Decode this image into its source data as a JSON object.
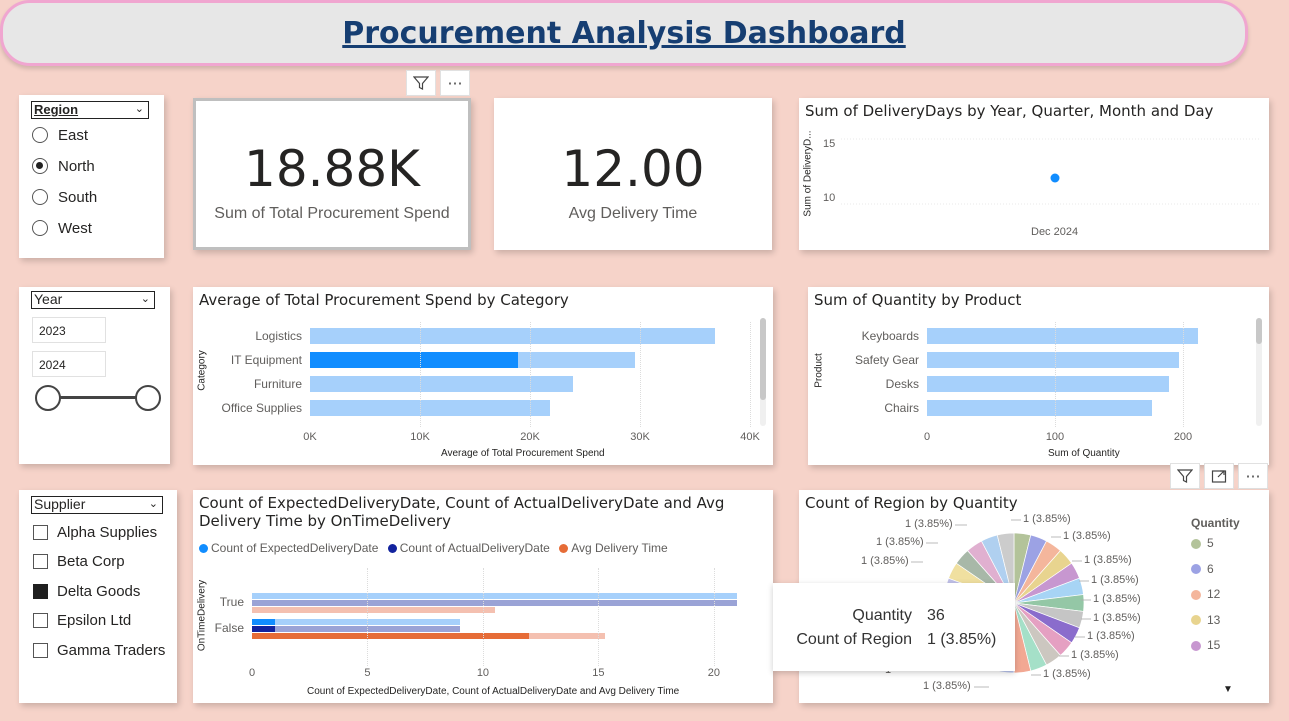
{
  "title": "Procurement Analysis Dashboard",
  "region_slicer": {
    "header": "Region",
    "items": [
      {
        "label": "East",
        "selected": false
      },
      {
        "label": "North",
        "selected": true
      },
      {
        "label": "South",
        "selected": false
      },
      {
        "label": "West",
        "selected": false
      }
    ]
  },
  "year_slicer": {
    "header": "Year",
    "from": "2023",
    "to": "2024"
  },
  "supplier_slicer": {
    "header": "Supplier",
    "items": [
      {
        "label": "Alpha Supplies",
        "checked": false
      },
      {
        "label": "Beta Corp",
        "checked": false
      },
      {
        "label": "Delta Goods",
        "checked": true
      },
      {
        "label": "Epsilon Ltd",
        "checked": false
      },
      {
        "label": "Gamma Traders",
        "checked": false
      }
    ]
  },
  "kpi_spend": {
    "value": "18.88K",
    "label": "Sum of Total Procurement Spend"
  },
  "kpi_delivery": {
    "value": "12.00",
    "label": "Avg Delivery Time"
  },
  "delivery_days_chart": {
    "title": "Sum of DeliveryDays by Year, Quarter, Month and Day",
    "ylabel": "Sum of DeliveryD...",
    "y_ticks": [
      "15",
      "10"
    ],
    "x_tick": "Dec 2024"
  },
  "category_chart": {
    "title": "Average of Total Procurement Spend by Category",
    "ylabel": "Category",
    "xlabel": "Average of Total Procurement Spend",
    "x_ticks": [
      "0K",
      "10K",
      "20K",
      "30K",
      "40K"
    ]
  },
  "product_chart": {
    "title": "Sum of Quantity by Product",
    "ylabel": "Product",
    "xlabel": "Sum of Quantity",
    "x_ticks": [
      "0",
      "100",
      "200"
    ]
  },
  "ontime_chart": {
    "title_line1": "Count of ExpectedDeliveryDate, Count of ActualDeliveryDate and Avg",
    "title_line2": "Delivery Time by OnTimeDelivery",
    "legend": [
      "Count of ExpectedDeliveryDate",
      "Count of ActualDeliveryDate",
      "Avg Delivery Time"
    ],
    "ylabel": "OnTimeDelivery",
    "xlabel": "Count of ExpectedDeliveryDate, Count of ActualDeliveryDate and Avg Delivery Time",
    "x_ticks": [
      "0",
      "5",
      "10",
      "15",
      "20"
    ]
  },
  "region_pie": {
    "title": "Count of Region by Quantity",
    "legend_title": "Quantity",
    "slice_label": "1 (3.85%)",
    "slice_label_stub": "1",
    "tooltip": {
      "k1": "Quantity",
      "v1": "36",
      "k2": "Count of Region",
      "v2": "1 (3.85%)"
    }
  },
  "chart_data": [
    {
      "type": "scatter",
      "title": "Sum of DeliveryDays by Year, Quarter, Month and Day",
      "x": [
        "Dec 2024"
      ],
      "y": [
        12
      ],
      "ylabel": "Sum of DeliveryD...",
      "ylim": [
        8,
        16
      ]
    },
    {
      "type": "bar",
      "orientation": "horizontal",
      "title": "Average of Total Procurement Spend by Category",
      "categories": [
        "Logistics",
        "IT Equipment",
        "Furniture",
        "Office Supplies"
      ],
      "values": [
        36800,
        29500,
        23900,
        21800
      ],
      "highlight_values": [
        null,
        18900,
        null,
        null
      ],
      "xlabel": "Average of Total Procurement Spend",
      "ylabel": "Category",
      "xlim": [
        0,
        40000
      ],
      "colors": {
        "base": "#a6d0fb",
        "highlight": "#118dff"
      }
    },
    {
      "type": "bar",
      "orientation": "horizontal",
      "title": "Sum of Quantity by Product",
      "categories": [
        "Keyboards",
        "Safety Gear",
        "Desks",
        "Chairs"
      ],
      "values": [
        212,
        197,
        189,
        176
      ],
      "xlabel": "Sum of Quantity",
      "ylabel": "Product",
      "xlim": [
        0,
        250
      ],
      "colors": {
        "base": "#a6d0fb"
      }
    },
    {
      "type": "bar",
      "orientation": "horizontal",
      "title": "Count of ExpectedDeliveryDate, Count of ActualDeliveryDate and Avg Delivery Time by OnTimeDelivery",
      "categories": [
        "True",
        "False"
      ],
      "series": [
        {
          "name": "Count of ExpectedDeliveryDate",
          "values": [
            21,
            9
          ],
          "highlight": [
            0,
            1
          ],
          "color": "#118dff",
          "base_color": "#a6d0fb"
        },
        {
          "name": "Count of ActualDeliveryDate",
          "values": [
            21,
            9
          ],
          "highlight": [
            0,
            1
          ],
          "color": "#12239e",
          "base_color": "#9aa3d6"
        },
        {
          "name": "Avg Delivery Time",
          "values": [
            10.5,
            15.3
          ],
          "highlight": [
            0,
            12
          ],
          "color": "#e66c37",
          "base_color": "#f4c0b0"
        }
      ],
      "xlim": [
        0,
        21
      ],
      "ylabel": "OnTimeDelivery"
    },
    {
      "type": "pie",
      "title": "Count of Region by Quantity",
      "legend_title": "Quantity",
      "legend": [
        "5",
        "6",
        "12",
        "13",
        "15"
      ],
      "slices_count": 26,
      "slice_value": 1,
      "slice_percent": 3.85,
      "colors": [
        "#b3c39a",
        "#9ca2e4",
        "#f4b69c",
        "#e8d48f",
        "#c797d0",
        "#a7d4f5",
        "#94c7a6",
        "#c5c5c5",
        "#8a6ccc",
        "#e5a0c2",
        "#ccc7c0",
        "#a5e0c8",
        "#f2a893",
        "#bcc7f0",
        "#d4cfb8",
        "#b06fd1",
        "#9bd4e0",
        "#e3c2e8",
        "#b8e3b0",
        "#d4a8a8",
        "#c0c0e8",
        "#f0e0a0",
        "#a8b8a8",
        "#e0b0d0",
        "#b0d0f0",
        "#cccccc"
      ]
    }
  ]
}
